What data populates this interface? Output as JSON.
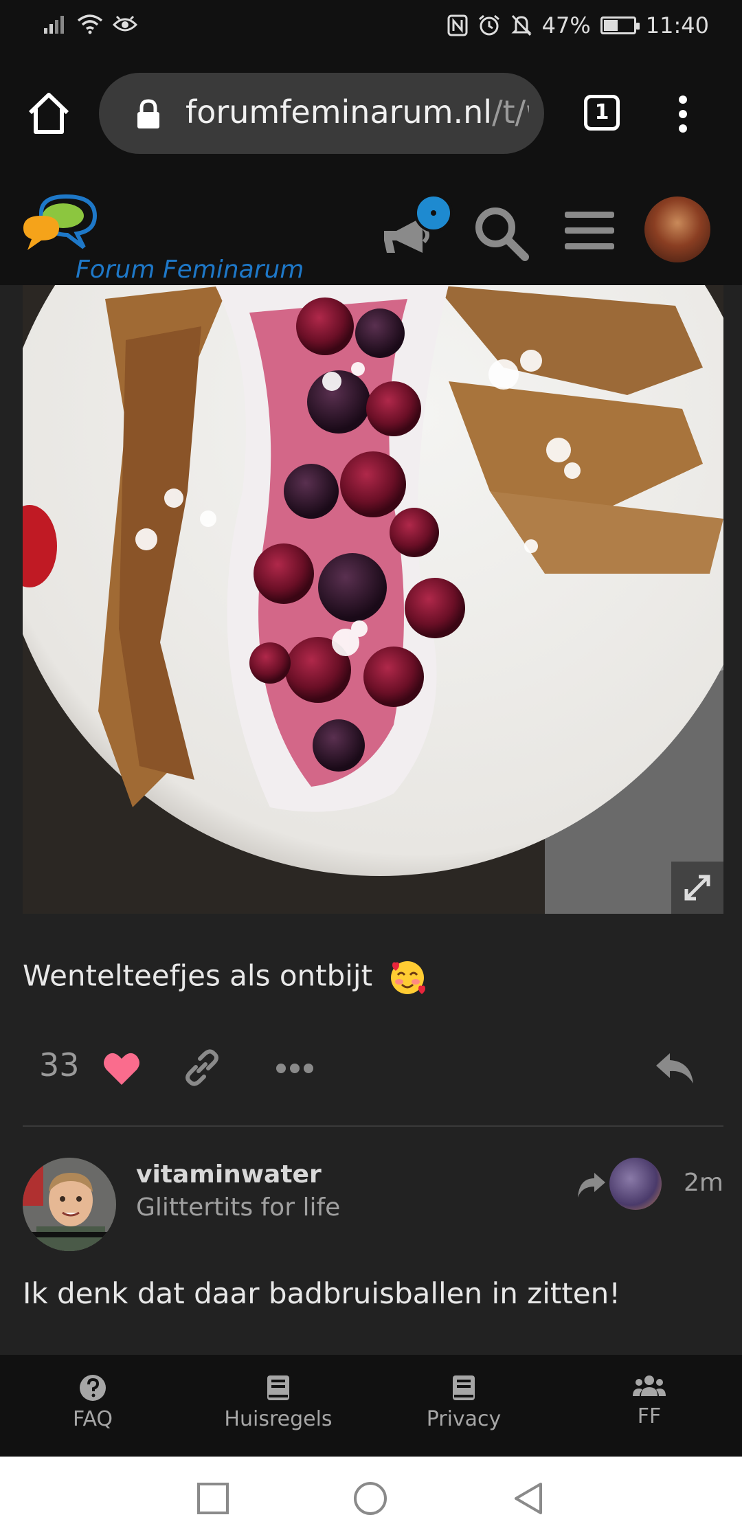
{
  "status_bar": {
    "battery_percent": "47%",
    "battery_level": 0.47,
    "time": "11:40",
    "icons": [
      "signal-icon",
      "wifi-icon",
      "eye-icon",
      "nfc-icon",
      "alarm-icon",
      "mute-bell-icon",
      "battery-icon"
    ]
  },
  "browser": {
    "url_domain": "forumfeminarum.nl",
    "url_path": "/t/w",
    "tab_count": "1",
    "icons": [
      "home-icon",
      "lock-icon",
      "more-vert-icon"
    ]
  },
  "forum": {
    "logo_text": "Forum Feminarum",
    "icons": [
      "notification-icon",
      "search-icon",
      "hamburger-icon",
      "avatar"
    ],
    "notification_color": "#1e8ad0"
  },
  "post": {
    "text": "Wentelteefjes als ontbijt",
    "emoji": "smiling-face-with-hearts",
    "like_count": "33",
    "heart_color": "#fa6c8d"
  },
  "reply": {
    "username": "vitaminwater",
    "user_title": "Glittertits for life",
    "time": "2m",
    "text": "Ik denk dat daar badbruisballen in zitten!"
  },
  "bottom_nav": {
    "items": [
      {
        "label": "FAQ",
        "icon": "question-icon"
      },
      {
        "label": "Huisregels",
        "icon": "book-icon"
      },
      {
        "label": "Privacy",
        "icon": "book-icon"
      },
      {
        "label": "FF",
        "icon": "users-icon"
      }
    ]
  },
  "colors": {
    "background": "#222222",
    "header": "#111111",
    "logo_blue": "#1e78c8"
  }
}
